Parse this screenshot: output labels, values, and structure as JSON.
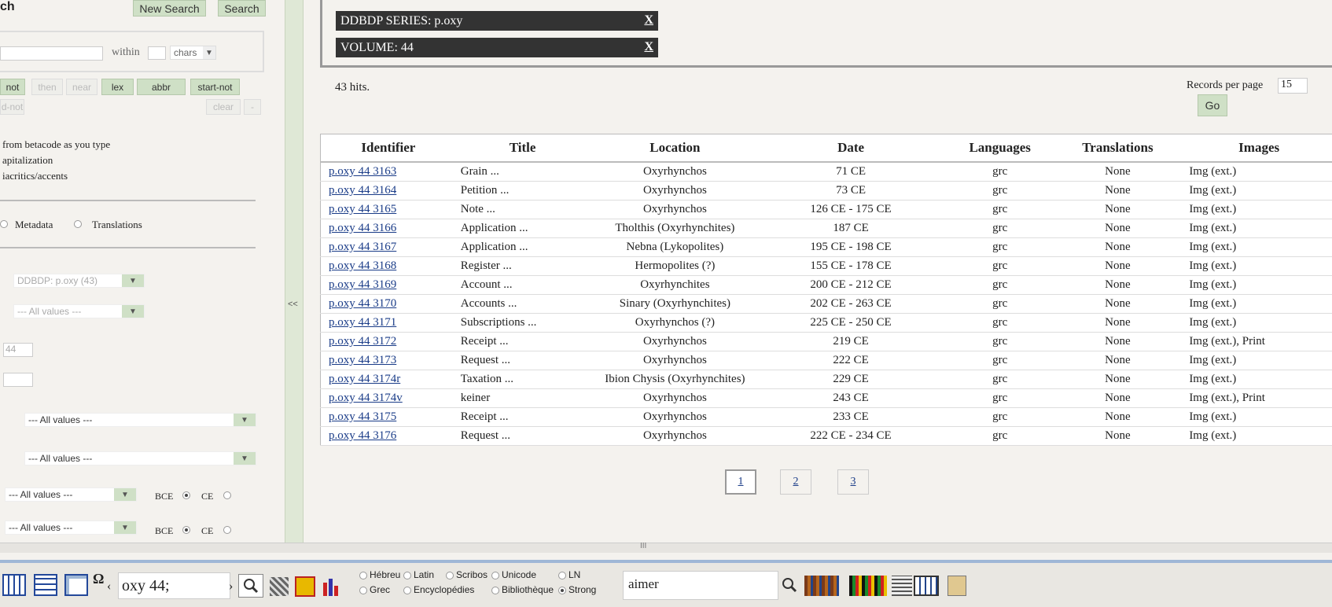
{
  "left": {
    "title_fragment": "ch",
    "new_search": "New Search",
    "search": "Search",
    "within": "within",
    "chars": "chars",
    "ops": [
      "not",
      "then",
      "near",
      "lex",
      "abbr",
      "start-not"
    ],
    "ops2": [
      "d-not",
      "clear",
      "-"
    ],
    "opt1": "from betacode as you type",
    "opt2": "apitalization",
    "opt3": "iacritics/accents",
    "metadata": "Metadata",
    "translations": "Translations",
    "series_select": "DDBDP: p.oxy (43)",
    "all_values": "--- All values ---",
    "volume_value": "44",
    "bce": "BCE",
    "ce": "CE",
    "collapse": "<<"
  },
  "filters": [
    {
      "label": "DDBDP SERIES: p.oxy",
      "remove": "X"
    },
    {
      "label": "VOLUME: 44",
      "remove": "X"
    }
  ],
  "hits": "43 hits.",
  "records_per_page_label": "Records per page",
  "records_per_page": "15",
  "go": "Go",
  "columns": [
    "Identifier",
    "Title",
    "Location",
    "Date",
    "Languages",
    "Translations",
    "Images"
  ],
  "rows": [
    {
      "id": "p.oxy 44 3163",
      "title": "Grain ...",
      "location": "Oxyrhynchos",
      "date": "71 CE",
      "lang": "grc",
      "trans": "None",
      "images": "Img (ext.)"
    },
    {
      "id": "p.oxy 44 3164",
      "title": "Petition ...",
      "location": "Oxyrhynchos",
      "date": "73 CE",
      "lang": "grc",
      "trans": "None",
      "images": "Img (ext.)"
    },
    {
      "id": "p.oxy 44 3165",
      "title": "Note ...",
      "location": "Oxyrhynchos",
      "date": "126 CE - 175 CE",
      "lang": "grc",
      "trans": "None",
      "images": "Img (ext.)"
    },
    {
      "id": "p.oxy 44 3166",
      "title": "Application ...",
      "location": "Tholthis (Oxyrhynchites)",
      "date": "187 CE",
      "lang": "grc",
      "trans": "None",
      "images": "Img (ext.)"
    },
    {
      "id": "p.oxy 44 3167",
      "title": "Application ...",
      "location": "Nebna (Lykopolites)",
      "date": "195 CE - 198 CE",
      "lang": "grc",
      "trans": "None",
      "images": "Img (ext.)"
    },
    {
      "id": "p.oxy 44 3168",
      "title": "Register ...",
      "location": "Hermopolites (?)",
      "date": "155 CE - 178 CE",
      "lang": "grc",
      "trans": "None",
      "images": "Img (ext.)"
    },
    {
      "id": "p.oxy 44 3169",
      "title": "Account ...",
      "location": "Oxyrhynchites",
      "date": "200 CE - 212 CE",
      "lang": "grc",
      "trans": "None",
      "images": "Img (ext.)"
    },
    {
      "id": "p.oxy 44 3170",
      "title": "Accounts ...",
      "location": "Sinary (Oxyrhynchites)",
      "date": "202 CE - 263 CE",
      "lang": "grc",
      "trans": "None",
      "images": "Img (ext.)"
    },
    {
      "id": "p.oxy 44 3171",
      "title": "Subscriptions ...",
      "location": "Oxyrhynchos (?)",
      "date": "225 CE - 250 CE",
      "lang": "grc",
      "trans": "None",
      "images": "Img (ext.)"
    },
    {
      "id": "p.oxy 44 3172",
      "title": "Receipt ...",
      "location": "Oxyrhynchos",
      "date": "219 CE",
      "lang": "grc",
      "trans": "None",
      "images": "Img (ext.), Print"
    },
    {
      "id": "p.oxy 44 3173",
      "title": "Request ...",
      "location": "Oxyrhynchos",
      "date": "222 CE",
      "lang": "grc",
      "trans": "None",
      "images": "Img (ext.)"
    },
    {
      "id": "p.oxy 44 3174r",
      "title": "Taxation ...",
      "location": "Ibion Chysis (Oxyrhynchites)",
      "date": "229 CE",
      "lang": "grc",
      "trans": "None",
      "images": "Img (ext.)"
    },
    {
      "id": "p.oxy 44 3174v",
      "title": "keiner",
      "location": "Oxyrhynchos",
      "date": "243 CE",
      "lang": "grc",
      "trans": "None",
      "images": "Img (ext.), Print"
    },
    {
      "id": "p.oxy 44 3175",
      "title": "Receipt ...",
      "location": "Oxyrhynchos",
      "date": "233 CE",
      "lang": "grc",
      "trans": "None",
      "images": "Img (ext.)"
    },
    {
      "id": "p.oxy 44 3176",
      "title": "Request ...",
      "location": "Oxyrhynchos",
      "date": "222 CE - 234 CE",
      "lang": "grc",
      "trans": "None",
      "images": "Img (ext.)"
    }
  ],
  "pages": [
    "1",
    "2",
    "3"
  ],
  "current_page": "1",
  "splitter_grip": "III",
  "toolbar": {
    "omega": "Ω",
    "lt": "‹",
    "gt": "›",
    "query": "oxy 44;",
    "radios": [
      "Hébreu",
      "Latin",
      "Scribos",
      "Unicode",
      "LN",
      "Grec",
      "Encyclopédies",
      "Bibliothèque",
      "Strong"
    ],
    "selected_radio": "Strong",
    "search2": "aimer"
  }
}
